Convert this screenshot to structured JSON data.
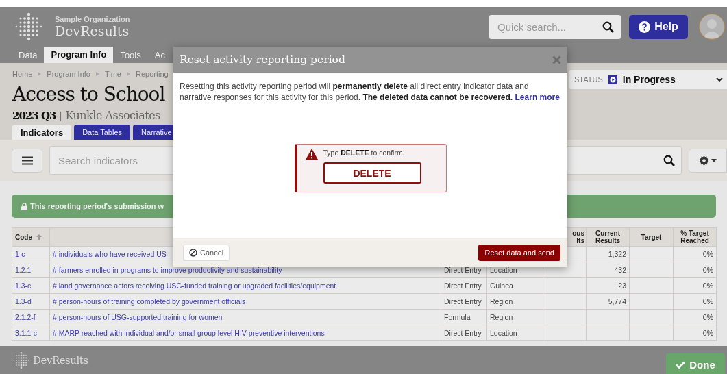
{
  "header": {
    "org": "Sample Organization",
    "app": "DevResults",
    "search": {
      "placeholder": "Quick search..."
    },
    "help": "Help"
  },
  "nav": [
    {
      "label": "Data",
      "selected": false
    },
    {
      "label": "Program Info",
      "selected": true
    },
    {
      "label": "Tools",
      "selected": false
    },
    {
      "label": "Ac",
      "selected": false
    }
  ],
  "breadcrumb": [
    "Home",
    "Program Info",
    "Time",
    "Reporting"
  ],
  "title": "Access to School",
  "period": "2023 Q3",
  "separator": "|",
  "partner": "Kunkle Associates",
  "status": {
    "label": "STATUS",
    "value": "In Progress"
  },
  "subtabs": [
    {
      "label": "Indicators",
      "selected": true
    },
    {
      "label": "Data Tables",
      "selected": false
    },
    {
      "label": "Narrative",
      "selected": false
    }
  ],
  "indicator_search": {
    "placeholder": "Search indicators"
  },
  "banner": "This reporting period's submission w",
  "table": {
    "columns": [
      {
        "label": "Code",
        "sorted": true
      },
      {
        "label": "ous lts"
      },
      {
        "label": "Current Results"
      },
      {
        "label": "Target"
      },
      {
        "label": "% Target Reached"
      }
    ],
    "rows": [
      {
        "code": "1-c",
        "indicator": "# individuals who have received US",
        "current": "1,322",
        "percent": "0%"
      },
      {
        "code": "1.2.1",
        "indicator": "# farmers enrolled in programs to improve productivity and sustainability",
        "type": "Direct Entry",
        "disaggregation": "Location",
        "current": "432",
        "percent": "0%"
      },
      {
        "code": "1.3-c",
        "indicator": "# land governance actors receiving USG-funded training or upgraded facilities/equipment",
        "type": "Direct Entry",
        "disaggregation": "Guinea",
        "current": "23",
        "percent": "0%"
      },
      {
        "code": "1.3-d",
        "indicator": "# person-hours of training completed by government officials",
        "type": "Direct Entry",
        "disaggregation": "Region",
        "current": "5,774",
        "percent": "0%"
      },
      {
        "code": "2.1.2-f",
        "indicator": "# person-hours of USG-supported training for women",
        "type": "Formula",
        "disaggregation": "Region",
        "percent": "0%"
      },
      {
        "code": "3.1.1-c",
        "indicator": "# MARP reached with individual and/or small group level HIV preventive interventions",
        "type": "Direct Entry",
        "disaggregation": "Location",
        "percent": "0%"
      }
    ]
  },
  "footer": {
    "app": "DevResults",
    "done": "Done"
  },
  "dialog": {
    "title": "Reset activity reporting period",
    "message": "Resetting this activity reporting period will **permanently delete** all direct entry indicator data and narrative responses for this activity for this period. **The deleted data cannot be recovered.**",
    "link": "Learn more",
    "confirm_prompt": "Type **DELETE** to confirm.",
    "confirm_value": "DELETE",
    "cancel": "Cancel",
    "submit": "Reset data and send"
  }
}
